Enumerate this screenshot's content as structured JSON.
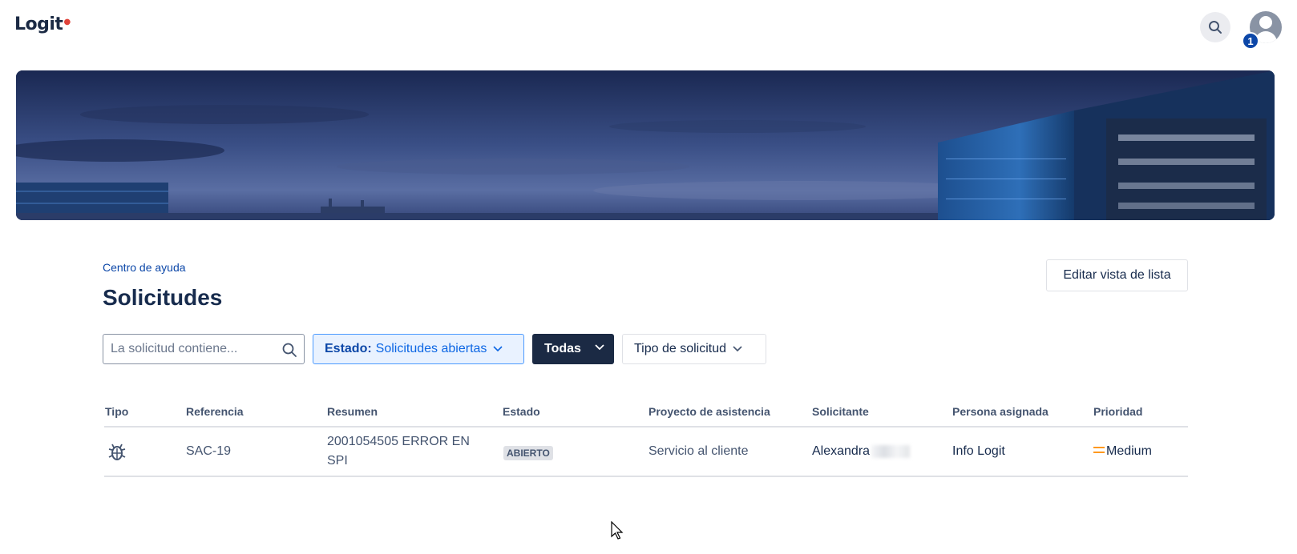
{
  "header": {
    "logo_text": "Logit",
    "notification_count": "1"
  },
  "breadcrumb": "Centro de ayuda",
  "page_title": "Solicitudes",
  "edit_button_label": "Editar vista de lista",
  "filters": {
    "search_placeholder": "La solicitud contiene...",
    "search_value": "",
    "estado_label": "Estado:",
    "estado_value": "Solicitudes abiertas",
    "todas_label": "Todas",
    "tipo_label": "Tipo de solicitud"
  },
  "table": {
    "columns": [
      "Tipo",
      "Referencia",
      "Resumen",
      "Estado",
      "Proyecto de asistencia",
      "Solicitante",
      "Persona asignada",
      "Prioridad"
    ],
    "rows": [
      {
        "type_icon": "bug-icon",
        "reference": "SAC-19",
        "summary_line1": "2001054505 ERROR EN",
        "summary_line2": "SPI",
        "status": "ABIERTO",
        "project": "Servicio al cliente",
        "requester": "Alexandra",
        "assignee": "Info Logit",
        "priority": "Medium"
      }
    ]
  },
  "colors": {
    "primary_dark": "#1b2a44",
    "link_blue": "#0c47a8",
    "selected_filter_bg": "#e9f2ff",
    "priority_medium": "#ff991f"
  }
}
